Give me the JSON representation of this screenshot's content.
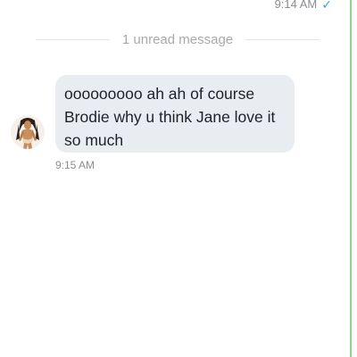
{
  "previous_message": {
    "time": "9:14 AM",
    "status_icon": "check-icon",
    "status_color": "#3aa0e8"
  },
  "divider": {
    "label": "1 unread message"
  },
  "message": {
    "sender_avatar_icon": "contact-avatar",
    "text": "ooooooooo ah ah of course Brodie why u think Jane love it so much",
    "time": "9:15 AM",
    "bubble_color": "#e9ecf0"
  }
}
